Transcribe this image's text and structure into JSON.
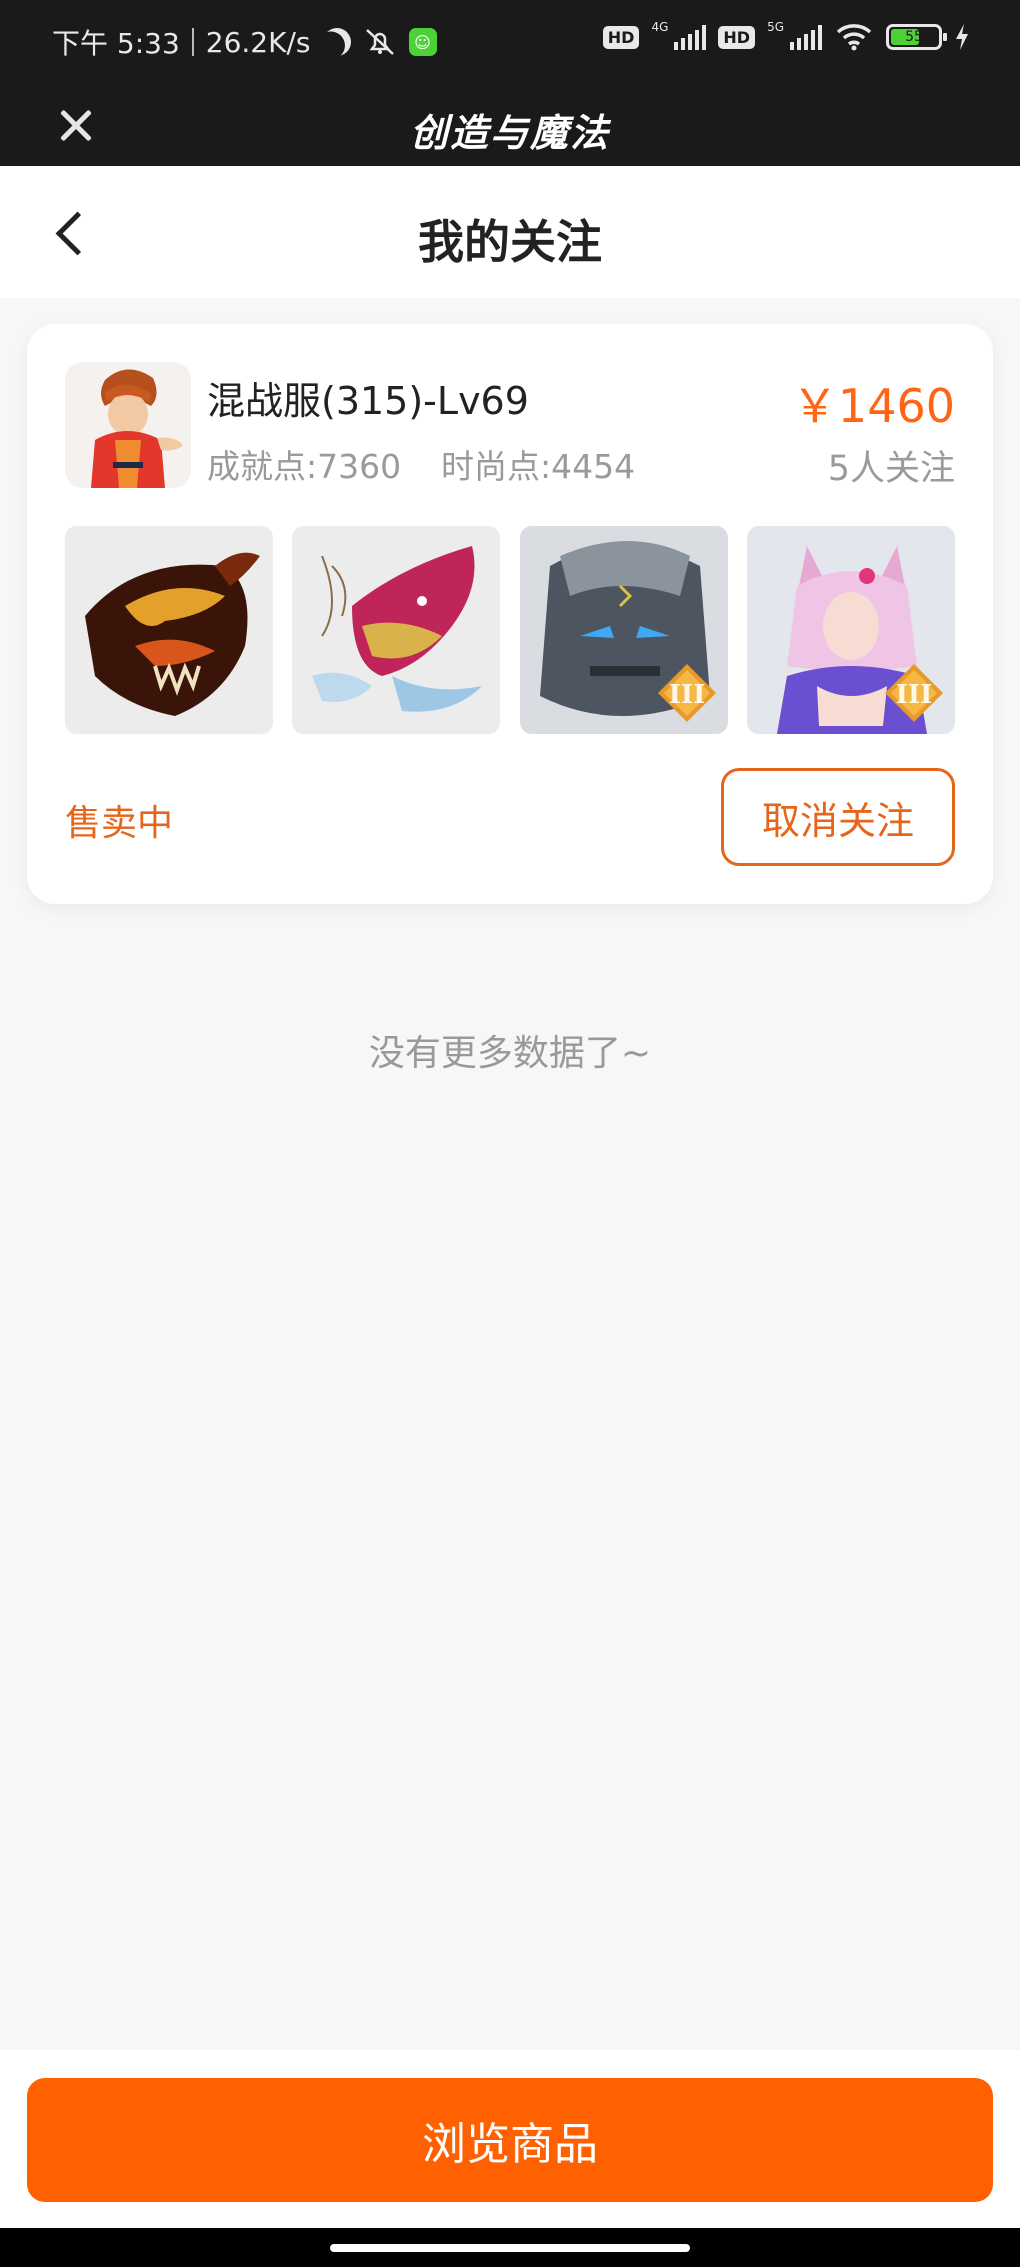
{
  "status_bar": {
    "time": "下午 5:33",
    "net_speed": "26.2K/s",
    "hd1": "HD",
    "net1": "4G",
    "hd2": "HD",
    "net2": "5G",
    "battery": "55"
  },
  "app_bar": {
    "title": "创造与魔法"
  },
  "header": {
    "title": "我的关注"
  },
  "card": {
    "title": "混战服(315)-Lv69",
    "achievement": "成就点:7360",
    "fashion": "时尚点:4454",
    "price": "￥1460",
    "followers": "5人关注",
    "status": "售卖中",
    "unfollow_label": "取消关注",
    "thumbnails": [
      {
        "name": "dark-dragon-mount",
        "tier": ""
      },
      {
        "name": "pink-dragon-mount",
        "tier": ""
      },
      {
        "name": "stone-golem-pet",
        "tier": "III"
      },
      {
        "name": "fox-spirit-character",
        "tier": "III"
      }
    ]
  },
  "footer_text": "没有更多数据了~",
  "bottom": {
    "browse_label": "浏览商品"
  },
  "colors": {
    "accent": "#ff6000",
    "price": "#ff6512",
    "status": "#e5651a",
    "header_bg": "#1a1a1a"
  }
}
